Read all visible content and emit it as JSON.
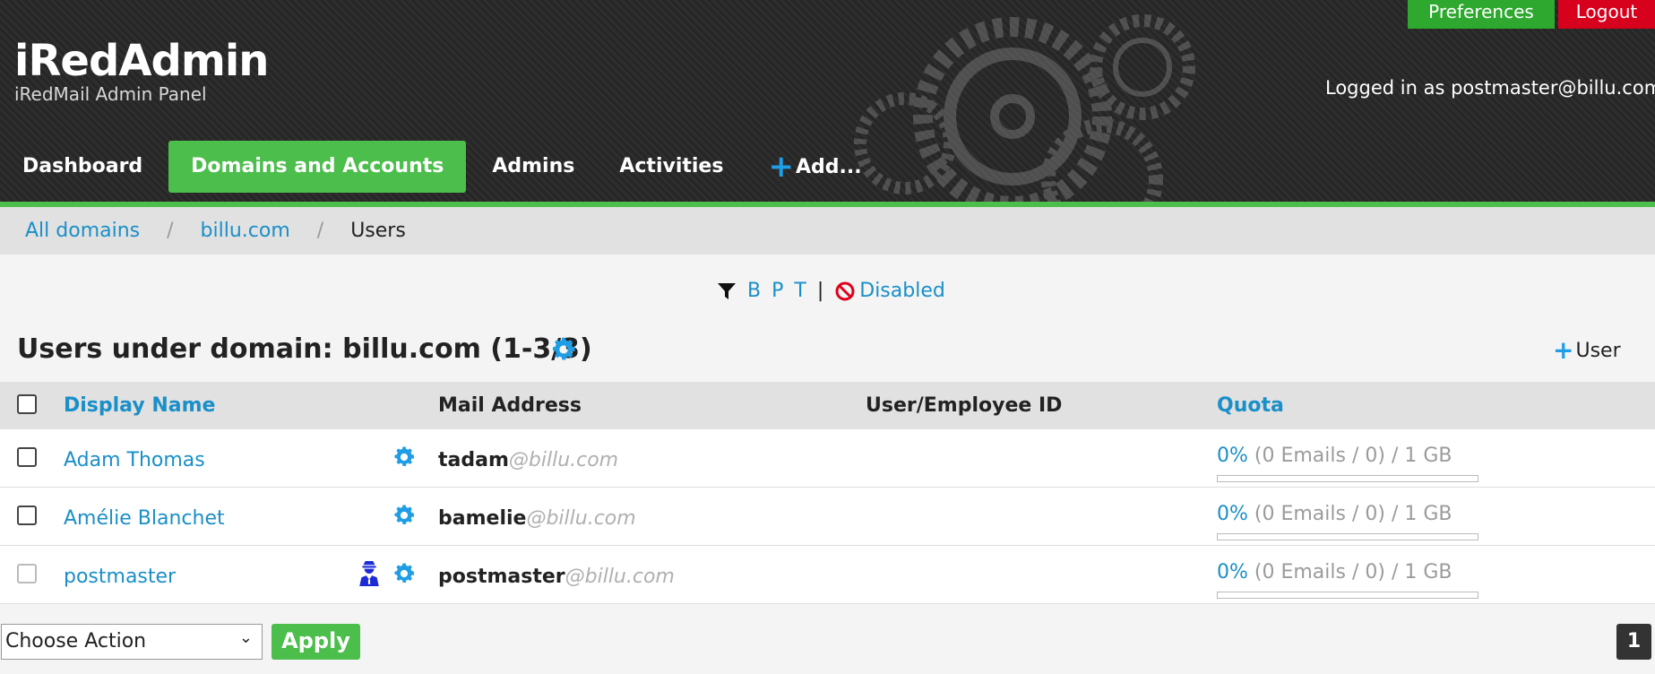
{
  "header": {
    "brand_title": "iRedAdmin",
    "brand_subtitle": "iRedMail Admin Panel",
    "preferences_label": "Preferences",
    "logout_label": "Logout",
    "login_info": "Logged in as postmaster@billu.com",
    "nav": [
      {
        "label": "Dashboard",
        "active": false
      },
      {
        "label": "Domains and Accounts",
        "active": true
      },
      {
        "label": "Admins",
        "active": false
      },
      {
        "label": "Activities",
        "active": false
      },
      {
        "label": "Add...",
        "icon": "plus-icon",
        "active": false
      }
    ]
  },
  "breadcrumb": {
    "items": [
      "All domains",
      "billu.com",
      "Users"
    ],
    "separator": "/"
  },
  "filter": {
    "icon": "filter-icon",
    "letters": [
      "B",
      "P",
      "T"
    ],
    "divider": "|",
    "disabled_icon": "ban-icon",
    "disabled_label": "Disabled"
  },
  "panel": {
    "title": "Users under domain: billu.com (1-3/3)",
    "gear_icon": "gear-icon",
    "add_user_label": "User"
  },
  "table": {
    "columns": [
      "Display Name",
      "Mail Address",
      "User/Employee ID",
      "Quota"
    ],
    "rows": [
      {
        "name": "Adam Thomas",
        "mail_user": "tadam",
        "mail_domain": "@billu.com",
        "employee_id": "",
        "quota_pct": "0%",
        "quota_detail": " (0 Emails / 0) / 1 GB",
        "quota_fraction": 0,
        "is_admin": false
      },
      {
        "name": "Amélie Blanchet",
        "mail_user": "bamelie",
        "mail_domain": "@billu.com",
        "employee_id": "",
        "quota_pct": "0%",
        "quota_detail": " (0 Emails / 0) / 1 GB",
        "quota_fraction": 0,
        "is_admin": false
      },
      {
        "name": "postmaster",
        "mail_user": "postmaster",
        "mail_domain": "@billu.com",
        "employee_id": "",
        "quota_pct": "0%",
        "quota_detail": " (0 Emails / 0) / 1 GB",
        "quota_fraction": 0,
        "is_admin": true
      }
    ]
  },
  "footer": {
    "action_select": "Choose Action",
    "apply_label": "Apply",
    "page": "1"
  },
  "colors": {
    "accent_green": "#4cbe4c",
    "logout_red": "#d7001d",
    "link_blue": "#1a8fc8",
    "icon_blue": "#1f9ee6"
  }
}
